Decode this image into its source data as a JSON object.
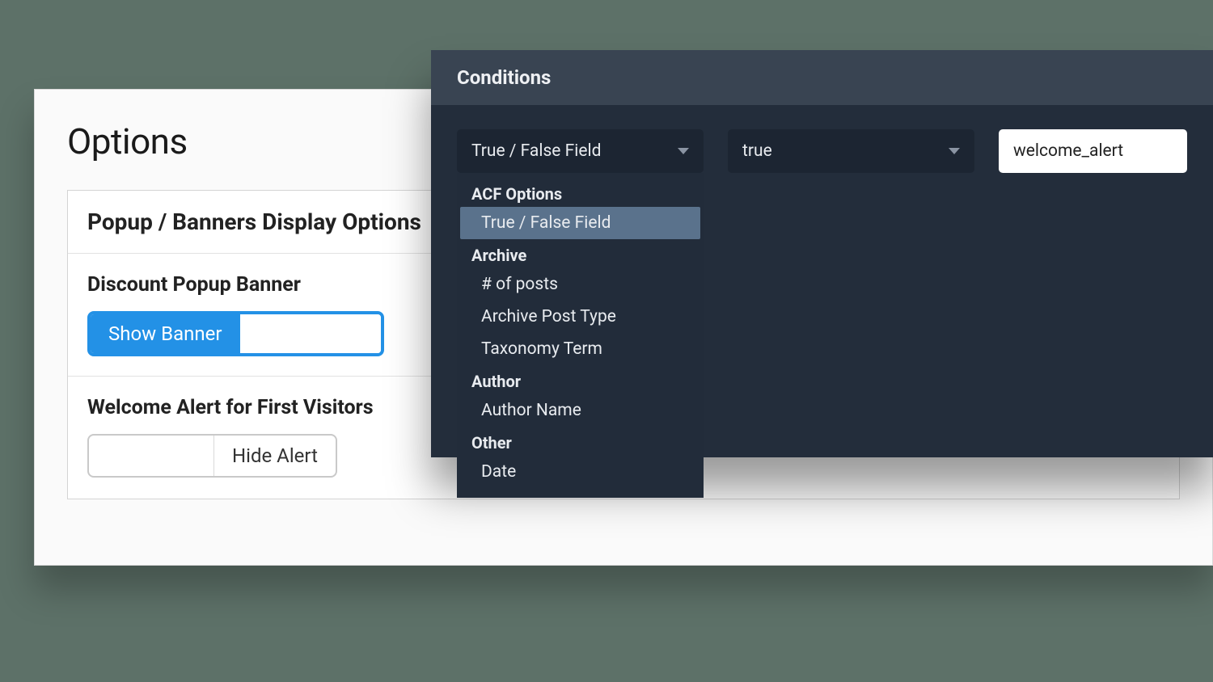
{
  "options": {
    "title": "Options",
    "box_header": "Popup / Banners Display Options",
    "discount": {
      "label": "Discount Popup Banner",
      "toggle_label": "Show Banner"
    },
    "welcome": {
      "label": "Welcome Alert for First Visitors",
      "toggle_label": "Hide Alert"
    }
  },
  "conditions": {
    "title": "Conditions",
    "field_select": "True / False Field",
    "value_select": "true",
    "text_input": "welcome_alert",
    "menu": {
      "g1": "ACF Options",
      "g1_i1": "True / False Field",
      "g2": "Archive",
      "g2_i1": "# of posts",
      "g2_i2": "Archive Post Type",
      "g2_i3": "Taxonomy Term",
      "g3": "Author",
      "g3_i1": "Author Name",
      "g4": "Other",
      "g4_i1": "Date"
    }
  }
}
